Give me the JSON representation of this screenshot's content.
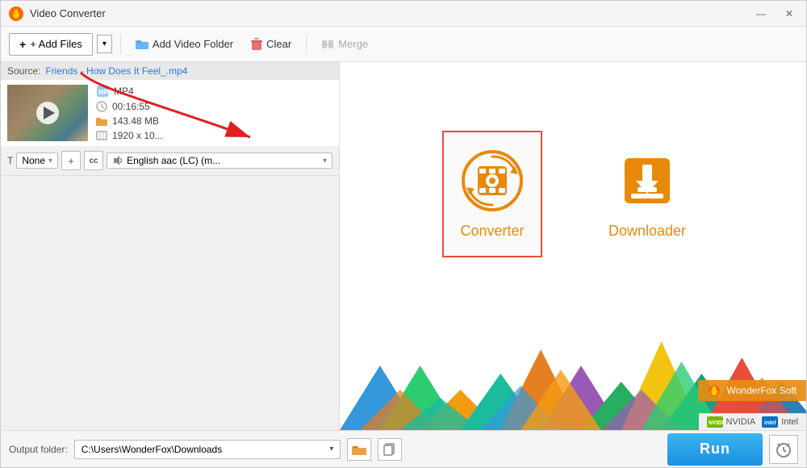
{
  "window": {
    "title": "Video Converter",
    "min_btn": "—",
    "close_btn": "✕"
  },
  "toolbar": {
    "add_files_label": "+ Add Files",
    "add_video_folder_label": "Add Video Folder",
    "clear_label": "Clear",
    "merge_label": "Merge",
    "dropdown_arrow": "▾"
  },
  "file": {
    "source_label": "Source:",
    "source_name": "Friends - How Does It Feel_.mp4",
    "format": "MP4",
    "duration": "00:16:55",
    "size": "143.48 MB",
    "resolution": "1920 x 10...",
    "audio_track": "English aac (LC) (m..."
  },
  "controls": {
    "subtitle_label": "None",
    "add_icon": "+",
    "cc_icon": "cc",
    "audio_icon": "♪"
  },
  "features": {
    "converter": {
      "label": "Converter"
    },
    "downloader": {
      "label": "Downloader"
    }
  },
  "branding": {
    "wonderfox": "WonderFox Soft",
    "nvidia": "NVIDIA",
    "intel": "Intel"
  },
  "bottom": {
    "output_label": "Output folder:",
    "output_path": "C:\\Users\\WonderFox\\Downloads",
    "run_label": "Run"
  },
  "colors": {
    "orange": "#e8890a",
    "red_border": "#e74c3c",
    "blue_btn": "#1a90e0",
    "arrow_red": "#e02020"
  }
}
